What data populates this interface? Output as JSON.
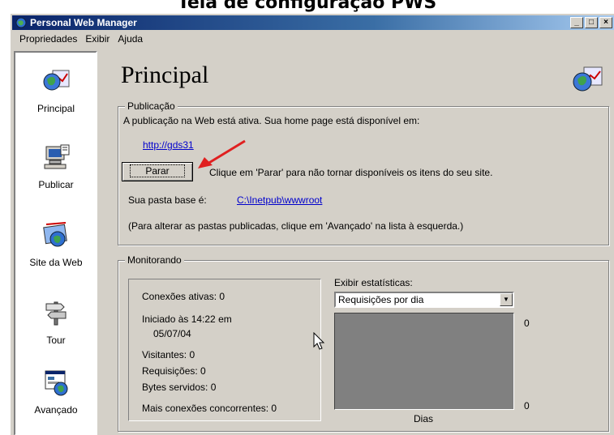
{
  "heading": "Tela de configuração PWS",
  "window": {
    "title": "Personal Web Manager",
    "controls": [
      "_",
      "□",
      "×"
    ]
  },
  "menu": {
    "items": [
      {
        "label": "Propriedades"
      },
      {
        "label": "Exibir"
      },
      {
        "label": "Ajuda"
      }
    ]
  },
  "sidebar": {
    "items": [
      {
        "label": "Principal",
        "icon": "globe-chart-icon"
      },
      {
        "label": "Publicar",
        "icon": "computer-publish-icon"
      },
      {
        "label": "Site da Web",
        "icon": "web-site-icon"
      },
      {
        "label": "Tour",
        "icon": "tour-signpost-icon"
      },
      {
        "label": "Avançado",
        "icon": "advanced-settings-icon"
      }
    ]
  },
  "main": {
    "title": "Principal",
    "publicacao": {
      "legend": "Publicação",
      "status_text": "A publicação na Web está ativa. Sua home page está disponível em:",
      "home_url": "http://gds31",
      "stop_button": "Parar",
      "stop_hint": "Clique em 'Parar' para não tornar disponíveis os itens do seu site.",
      "base_folder_label": "Sua pasta base é:",
      "base_folder_path": "C:\\Inetpub\\wwwroot",
      "note": "(Para alterar as pastas publicadas, clique em 'Avançado' na lista à esquerda.)"
    },
    "monitorando": {
      "legend": "Monitorando",
      "conexoes_ativas": "Conexões ativas:   0",
      "iniciado_line1": "Iniciado às 14:22 em",
      "iniciado_line2": "05/07/04",
      "visitantes": "Visitantes:  0",
      "requisicoes": "Requisições:   0",
      "bytes_servidos": "Bytes servidos:   0",
      "mais_conexoes": "Mais conexões concorrentes:  0",
      "exibir_label": "Exibir estatísticas:",
      "exibir_selected": "Requisições por dia",
      "graph_top_value": "0",
      "graph_bottom_value": "0",
      "graph_xlabel": "Dias"
    }
  }
}
